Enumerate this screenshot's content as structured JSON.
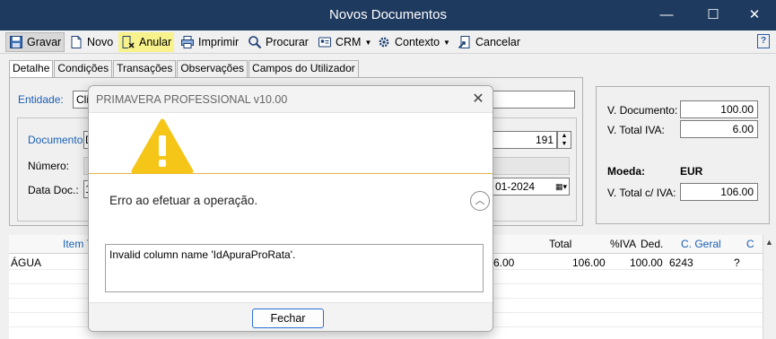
{
  "window": {
    "title": "Novos Documentos",
    "minimize_glyph": "—",
    "maximize_glyph": "☐",
    "close_glyph": "✕"
  },
  "toolbar": {
    "gravar": "Gravar",
    "novo": "Novo",
    "anular": "Anular",
    "imprimir": "Imprimir",
    "procurar": "Procurar",
    "crm": "CRM",
    "contexto": "Contexto",
    "cancelar": "Cancelar",
    "help": "?"
  },
  "tabs": [
    "Detalhe",
    "Condições",
    "Transações",
    "Observações",
    "Campos do Utilizador"
  ],
  "header": {
    "entidade_label": "Entidade:",
    "entidade_value": "Clie",
    "documento_label": "Documento:",
    "documento_value": "D",
    "numero_doc_value": "191",
    "numero_label": "Número:",
    "data_label": "Data Doc.:",
    "data_prefix": "1",
    "data_value": "01-2024"
  },
  "totals": {
    "v_documento_label": "V. Documento:",
    "v_documento": "100.00",
    "v_total_iva_label": "V. Total IVA:",
    "v_total_iva": "6.00",
    "moeda_label": "Moeda:",
    "moeda": "EUR",
    "v_total_civa_label": "V. Total c/ IVA:",
    "v_total_civa": "106.00"
  },
  "grid": {
    "columns": {
      "item": "Item T",
      "total": "Total",
      "iva": "%IVA",
      "ded": "Ded.",
      "cgeral": "C. Geral",
      "c": "C"
    },
    "row": {
      "item": "ÁGUA",
      "partial": "6.00",
      "total": "106.00",
      "iva": "100.00",
      "cgeral": "6243",
      "c": "?"
    }
  },
  "dialog": {
    "title": "PRIMAVERA PROFESSIONAL v10.00",
    "message": "Erro ao efetuar a operação.",
    "detail": "Invalid column name 'IdApuraProRata'.",
    "button": "Fechar",
    "warning_color": "#f5c518",
    "expand_glyph": "︿"
  }
}
